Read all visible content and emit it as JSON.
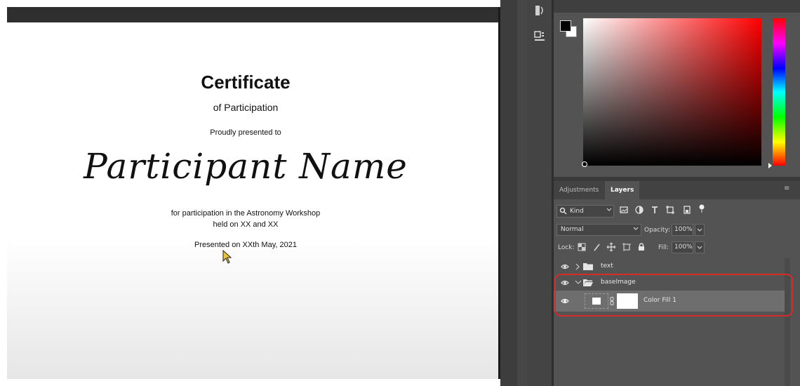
{
  "certificate": {
    "title": "Certificate",
    "subtitle": "of Participation",
    "presented_to": "Proudly presented to",
    "participant_name": "Participant Name",
    "participation_line": "for participation in the Astronomy Workshop",
    "held_line": "held on XX and XX",
    "presented_date": "Presented on XXth May, 2021"
  },
  "color_panel": {
    "foreground_color": "#000000",
    "background_color": "#ffffff",
    "hue": "#ff0000"
  },
  "layers_panel": {
    "tabs": [
      {
        "label": "Adjustments",
        "active": false
      },
      {
        "label": "Layers",
        "active": true
      }
    ],
    "menu_icon": "≡",
    "filter": {
      "kind_label": "Kind",
      "icons": [
        "image-filter-icon",
        "adjustment-filter-icon",
        "type-filter-icon",
        "shape-filter-icon",
        "smart-object-filter-icon",
        "filter-toggle-icon"
      ]
    },
    "blend_mode": "Normal",
    "opacity_label": "Opacity:",
    "opacity_value": "100%",
    "lock_label": "Lock:",
    "fill_label": "Fill:",
    "fill_value": "100%",
    "layers": [
      {
        "name": "text",
        "type": "group",
        "expanded": false,
        "visible": true
      },
      {
        "name": "baseImage",
        "type": "group",
        "expanded": true,
        "visible": true
      },
      {
        "name": "Color Fill 1",
        "type": "fill-layer",
        "visible": true,
        "selected": true
      }
    ]
  },
  "accent_colors": {
    "highlight_outline": "#d42b2b",
    "selected_row": "#6e6e6e"
  }
}
